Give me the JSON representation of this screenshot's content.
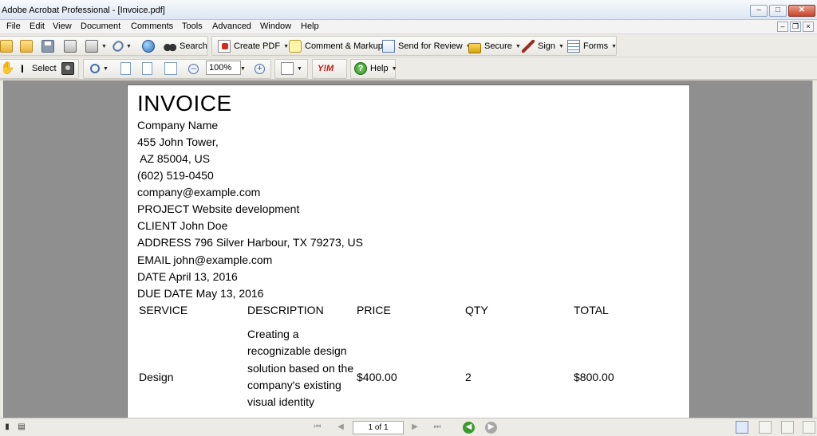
{
  "window": {
    "title": "Adobe Acrobat Professional - [Invoice.pdf]"
  },
  "menu": [
    "File",
    "Edit",
    "View",
    "Document",
    "Comments",
    "Tools",
    "Advanced",
    "Window",
    "Help"
  ],
  "toolbar1": {
    "search": "Search",
    "create_pdf": "Create PDF",
    "comment_markup": "Comment & Markup",
    "send_review": "Send for Review",
    "secure": "Secure",
    "sign": "Sign",
    "forms": "Forms"
  },
  "toolbar2": {
    "select": "Select",
    "zoom_value": "100%",
    "help": "Help",
    "yim": "Y!M"
  },
  "document": {
    "title": "INVOICE",
    "company_name": "Company Name",
    "address1": "455 John Tower,",
    "address2": " AZ 85004, US",
    "phone": "(602) 519-0450",
    "email": "company@example.com",
    "project": "PROJECT Website development",
    "client": "CLIENT John Doe",
    "client_address": "ADDRESS 796 Silver Harbour, TX 79273, US",
    "client_email": "EMAIL john@example.com",
    "date": "DATE April 13, 2016",
    "due_date": "DUE DATE May 13, 2016",
    "table": {
      "headers": [
        "SERVICE",
        "DESCRIPTION",
        "PRICE",
        "QTY",
        "TOTAL"
      ],
      "rows": [
        {
          "service": "Design",
          "description": "Creating a recognizable design solution based on the company's existing visual identity",
          "price": "$400.00",
          "qty": "2",
          "total": "$800.00"
        }
      ]
    }
  },
  "status": {
    "page": "1 of 1"
  }
}
